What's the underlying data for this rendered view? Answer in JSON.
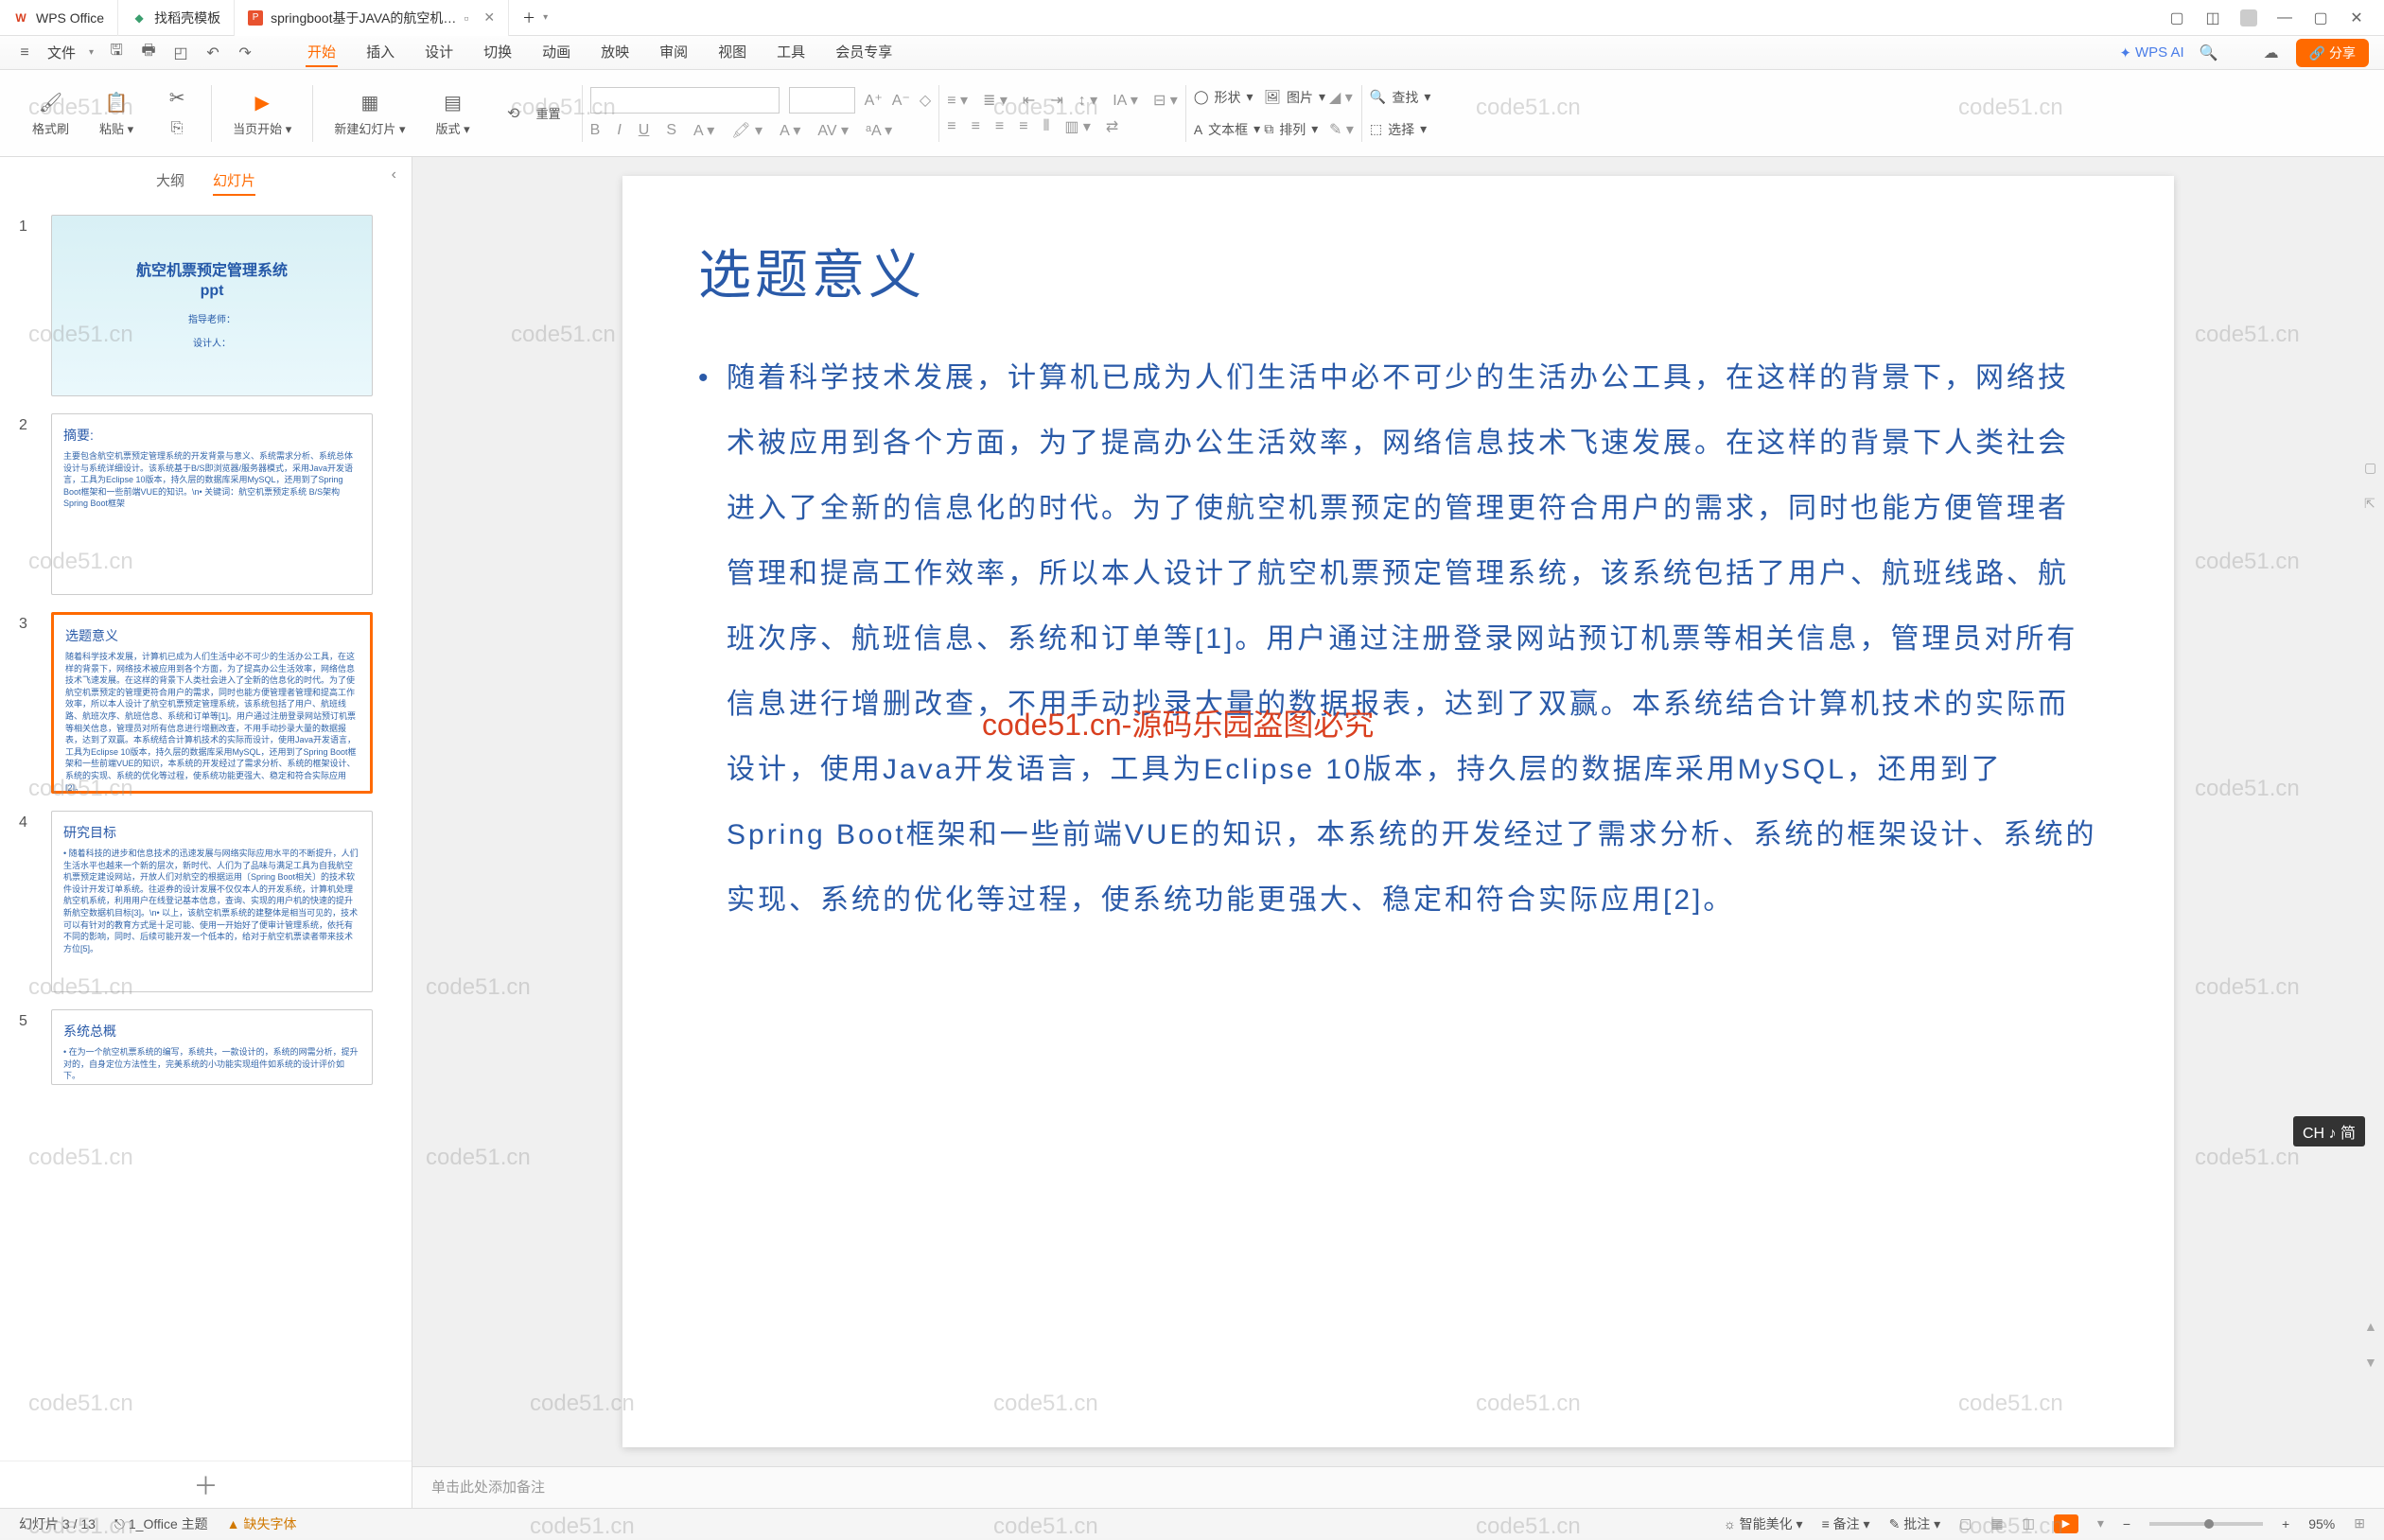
{
  "titlebar": {
    "app_name": "WPS Office",
    "tab2": "找稻壳模板",
    "tab3": "springboot基于JAVA的航空机…"
  },
  "menu": {
    "file": "文件",
    "tabs": {
      "start": "开始",
      "insert": "插入",
      "design": "设计",
      "transition": "切换",
      "animation": "动画",
      "slideshow": "放映",
      "review": "审阅",
      "view": "视图",
      "tools": "工具",
      "member": "会员专享"
    },
    "wps_ai": "WPS AI",
    "share": "分享"
  },
  "ribbon": {
    "format_painter": "格式刷",
    "paste": "粘贴",
    "from_current": "当页开始",
    "new_slide": "新建幻灯片",
    "layout": "版式",
    "reset": "重置",
    "shape": "形状",
    "image": "图片",
    "textbox": "文本框",
    "arrange": "排列",
    "find": "查找",
    "select": "选择"
  },
  "sidebar": {
    "outline": "大纲",
    "slides": "幻灯片",
    "t1_title": "航空机票预定管理系统",
    "t1_ppt": "ppt",
    "t1_teacher": "指导老师：",
    "t1_designer": "设计人：",
    "t2_title": "摘要:",
    "t2_body": "主要包含航空机票预定管理系统的开发背景与意义、系统需求分析、系统总体设计与系统详细设计。该系统基于B/S即浏览器/服务器模式，采用Java开发语言，工具为Eclipse 10版本，持久层的数据库采用MySQL，还用到了Spring Boot框架和一些前端VUE的知识。\\n• 关键词：航空机票预定系统 B/S架构 Spring Boot框架",
    "t3_title": "选题意义",
    "t3_body": "随着科学技术发展，计算机已成为人们生活中必不可少的生活办公工具，在这样的背景下，网络技术被应用到各个方面，为了提高办公生活效率，网络信息技术飞速发展。在这样的背景下人类社会进入了全新的信息化的时代。为了使航空机票预定的管理更符合用户的需求，同时也能方便管理者管理和提高工作效率，所以本人设计了航空机票预定管理系统，该系统包括了用户、航班线路、航班次序、航班信息、系统和订单等[1]。用户通过注册登录网站预订机票等相关信息，管理员对所有信息进行增删改查，不用手动抄录大量的数据报表，达到了双赢。本系统结合计算机技术的实际而设计，使用Java开发语言，工具为Eclipse 10版本，持久层的数据库采用MySQL，还用到了Spring Boot框架和一些前端VUE的知识，本系统的开发经过了需求分析、系统的框架设计、系统的实现、系统的优化等过程，使系统功能更强大、稳定和符合实际应用[2]。",
    "t4_title": "研究目标",
    "t4_body": "• 随着科技的进步和信息技术的迅速发展与网络实际应用水平的不断提升，人们生活水平也越来一个新的层次，新时代、人们为了品味与满足工具为自我航空机票预定建设网站，开放人们对航空的根据运用〔Spring Boot相关〕的技术软件设计开发订单系统。往返券的设计发展不仅仅本人的开发系统，计算机处理航空机系统，利用用户在线登记基本信息，查询、实现的用户机的快速的提升新航空数据机目标[3]。\\n• 以上，该航空机票系统的建整体是相当可见的，技术可以有针对的教育方式是十足可能、使用一开始好了便审计管理系统，依托有不同的影响，同时、后续可能开发一个低本的，给对于航空机票读者带来技术方位[5]。",
    "t5_title": "系统总概",
    "t5_body": "• 在为一个航空机票系统的编写，系统共，一款设计的，系统的网需分析，提升对的，自身定位方法性生，完美系统的小功能实现组件如系统的设计评价如下。"
  },
  "slide": {
    "title": "选题意义",
    "body": "随着科学技术发展，计算机已成为人们生活中必不可少的生活办公工具，在这样的背景下，网络技术被应用到各个方面，为了提高办公生活效率，网络信息技术飞速发展。在这样的背景下人类社会进入了全新的信息化的时代。为了使航空机票预定的管理更符合用户的需求，同时也能方便管理者管理和提高工作效率，所以本人设计了航空机票预定管理系统，该系统包括了用户、航班线路、航班次序、航班信息、系统和订单等[1]。用户通过注册登录网站预订机票等相关信息，管理员对所有信息进行增删改查，不用手动抄录大量的数据报表，达到了双赢。本系统结合计算机技术的实际而设计，使用Java开发语言，工具为Eclipse 10版本，持久层的数据库采用MySQL，还用到了Spring Boot框架和一些前端VUE的知识，本系统的开发经过了需求分析、系统的框架设计、系统的实现、系统的优化等过程，使系统功能更强大、稳定和符合实际应用[2]。"
  },
  "notes_placeholder": "单击此处添加备注",
  "status": {
    "slide_pos": "幻灯片 3 / 13",
    "theme": "1_Office 主题",
    "missing_font": "缺失字体",
    "smart_beauty": "智能美化",
    "notes": "备注",
    "review": "批注",
    "zoom": "95%"
  },
  "watermark": "code51.cn",
  "watermark_red": "code51.cn-源码乐园盗图必究",
  "ime": "CH ♪ 简"
}
